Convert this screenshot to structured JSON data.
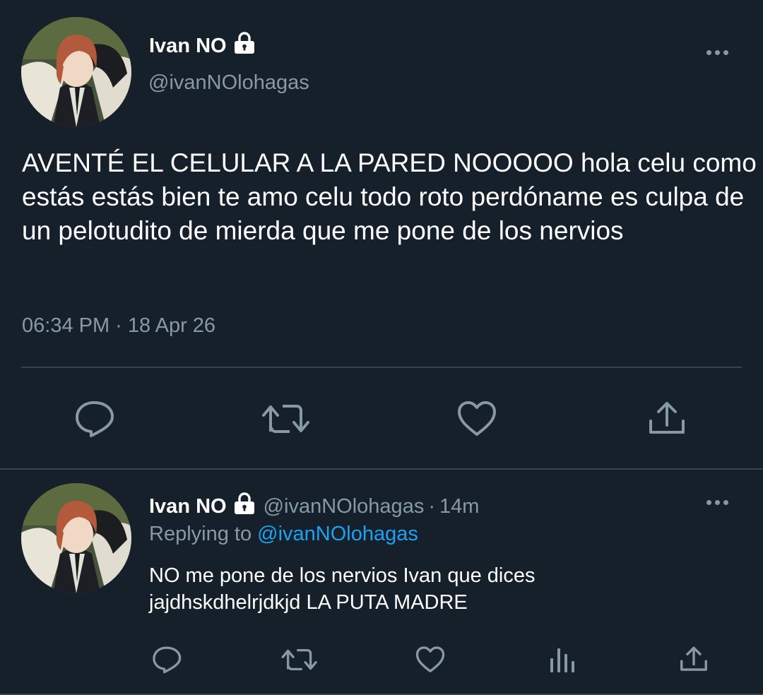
{
  "main_tweet": {
    "name": "Ivan NO",
    "handle": "@ivanNOlohagas",
    "text": "AVENTÉ EL CELULAR A LA PARED NOOOOO hola celu como estás estás bien te amo celu todo roto perdóname es culpa de un pelotudito de mierda que me pone de los nervios",
    "timestamp": "06:34 PM · 18 Apr 26",
    "actions": [
      "reply-icon",
      "retweet-icon",
      "like-icon",
      "share-icon"
    ]
  },
  "reply_tweet": {
    "name": "Ivan NO",
    "handle": "@ivanNOlohagas",
    "separator": "·",
    "time": "14m",
    "replying_prefix": "Replying to ",
    "replying_to": "@ivanNOlohagas",
    "text_line1": "NO me pone de los nervios Ivan que dices",
    "text_line2": "jajdhskdhelrjdkjd LA PUTA MADRE",
    "actions": [
      "reply-icon",
      "retweet-icon",
      "like-icon",
      "analytics-icon",
      "share-icon"
    ]
  },
  "colors": {
    "background": "#15202b",
    "secondary_text": "#8899a6",
    "link": "#1da1f2",
    "divider": "#38444d",
    "icon": "#8899a6"
  }
}
